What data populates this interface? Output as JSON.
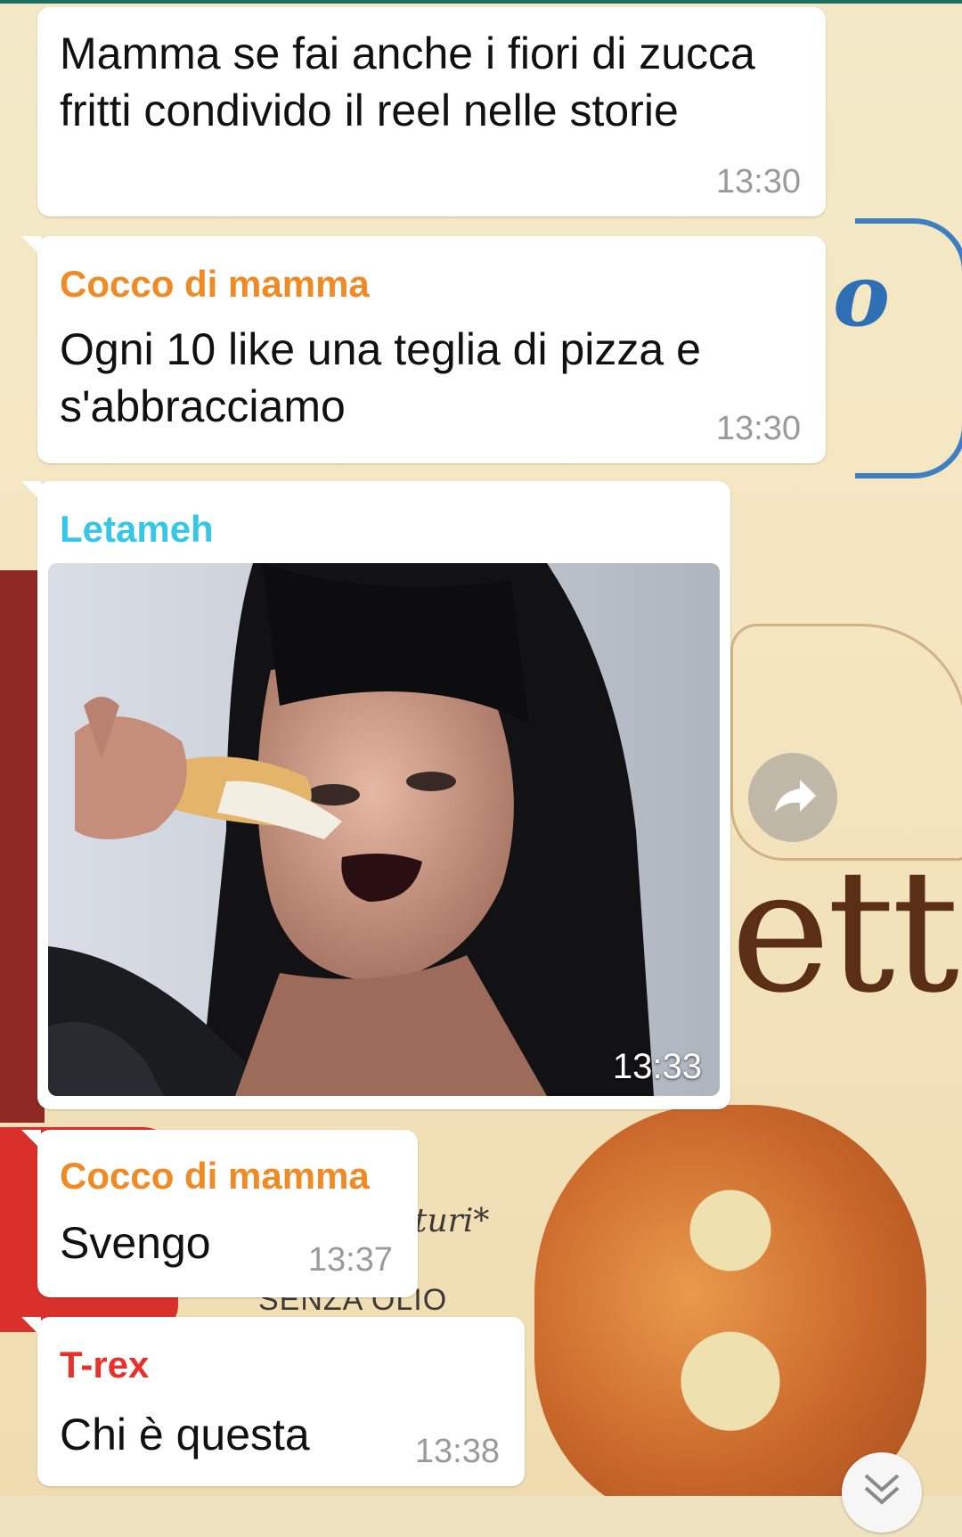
{
  "colors": {
    "sender_cocco": "#f08a24",
    "sender_letameh": "#35c6e8",
    "sender_trex": "#e8312b"
  },
  "messages": [
    {
      "text": "Mamma se fai anche i fiori di zucca fritti condivido il reel nelle storie",
      "time": "13:30"
    },
    {
      "sender": "Cocco di mamma",
      "text": "Ogni 10 like una teglia di pizza e s'abbracciamo",
      "time": "13:30"
    },
    {
      "sender": "Letameh",
      "media": "photo of a woman eating a slice of pizza",
      "time": "13:33"
    },
    {
      "sender": "Cocco di mamma",
      "text": "Svengo",
      "time": "13:37"
    },
    {
      "sender": "T-rex",
      "text": "Chi è questa",
      "time": "13:38"
    }
  ],
  "icons": {
    "forward": "forward-arrow-icon",
    "scroll_down": "chevron-down-icon"
  },
  "wallpaper": {
    "brand_fragment": "etti",
    "package_text": "SENZA OLIO",
    "tagline_fragment": "turi*"
  }
}
